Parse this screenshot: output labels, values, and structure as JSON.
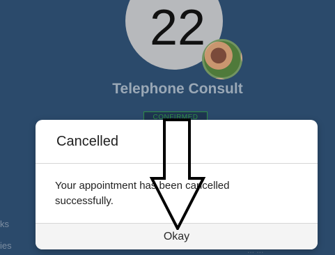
{
  "background": {
    "date_number": "22",
    "appointment_title": "Telephone Consult",
    "status_badge": "CONFIRMED",
    "left_menu_items": [
      "ks",
      "ies"
    ],
    "right_faint_text": "... ..."
  },
  "dialog": {
    "title": "Cancelled",
    "message": "Your appointment has been cancelled successfully.",
    "okay_button_label": "Okay"
  },
  "colors": {
    "page_background": "#2b4a6b",
    "confirmed_green": "#2f8d46"
  },
  "icons": {
    "annotation": "down-arrow-icon",
    "profile": "avatar"
  }
}
